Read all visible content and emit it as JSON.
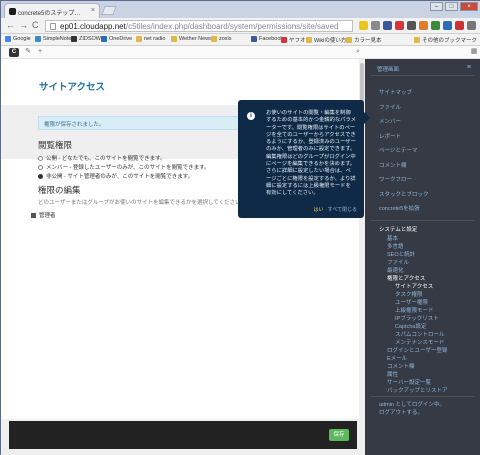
{
  "browser": {
    "tab_title": "concrete5のステップ…",
    "url_host": "ep01.cloudapp.net",
    "url_path": "/c5tiles/index.php/dashboard/system/permissions/site/saved",
    "back_glyph": "←",
    "forward_glyph": "→",
    "reload_glyph": "C",
    "close_tab_glyph": "×"
  },
  "bookmarks": {
    "items": [
      {
        "label": "Google",
        "color": "#4285f4"
      },
      {
        "label": "SimpleNote",
        "color": "#3b8ec2"
      },
      {
        "label": "ZIDSOW",
        "color": "#333333"
      },
      {
        "label": "OneDrive",
        "color": "#2a6ebb"
      },
      {
        "label": "net radio",
        "color": "#e0b84a"
      },
      {
        "label": "Wether News",
        "color": "#e0b84a"
      },
      {
        "label": "zoxis",
        "color": "#e0b84a"
      },
      {
        "label": "Facebook",
        "color": "#3b5998"
      },
      {
        "label": "ヤフオク",
        "color": "#d8343a"
      },
      {
        "label": "Wikiの使い方",
        "color": "#e0b84a"
      },
      {
        "label": "カラー見本",
        "color": "#e0b84a"
      }
    ],
    "other": "その他のブックマーク"
  },
  "c5toolbar": {
    "logo": "C",
    "edit_icon": "✎",
    "add_icon": "+",
    "search_icon": "⌕",
    "dashboard_icon": "▦"
  },
  "page": {
    "title": "サイトアクセス",
    "alert": "権限が保存されました。",
    "section1": "閲覧権限",
    "options": [
      {
        "label": "公開 - どなたでも、このサイトを閲覧できます。",
        "selected": false
      },
      {
        "label": "メンバー - 登録したユーザーのみが、このサイトを閲覧できます。",
        "selected": false
      },
      {
        "label": "非公開 - サイト管理者のみが、このサイトを閲覧できます。",
        "selected": true
      }
    ],
    "section2": "権限の編集",
    "section2_desc": "どのユーザーまたはグループがお使いのサイトを編集できるかを選択してください。注意",
    "group_checked": "管理者",
    "save_label": "保存"
  },
  "tooltip": {
    "text": "お使いのサイトの閲覧・編集を制御するための基本的かつ金銭的なパラメーターです。閲覧権限はサイトのページを全てのユーザーからアクセスできるようにするか、登録済みのユーザーのみか、管理者のみに設定できます。編集権限はどのグループがログイン中にページを編集できるかを決めます。さらに詳細に設定したい場合は、ページごとに権限を設定するか、より詳細に設定するには上級権限モードを有効にしてください。",
    "info_glyph": "i",
    "yes": "はい",
    "skip": "すべて閉じる"
  },
  "panel": {
    "title": "管理画面",
    "top_items": [
      "サイトマップ",
      "ファイル",
      "メンバー",
      "レポート",
      "ページとテーマ",
      "コメント欄",
      "ワークフロー",
      "スタックとブロック",
      "concrete5を拡張"
    ],
    "system_heading": "システムと設定",
    "system_items": [
      "基本",
      "多言語",
      "SEOと統計",
      "ファイル",
      "最適化"
    ],
    "permissions_heading": "権限とアクセス",
    "permission_items": [
      "サイトアクセス",
      "タスク権限",
      "ユーザー権限",
      "上級権限モード",
      "IPブラックリスト",
      "Captcha設定",
      "スパムコントロール",
      "メンテナンスモード"
    ],
    "permissions_active_index": 0,
    "more_items": [
      "ログインとユーザー登録",
      "Eメール",
      "コメント欄",
      "属性",
      "サーバー設定一覧",
      "バックアップとリストア"
    ],
    "logged_in": "admin としてログイン中。",
    "logout": "ログアウトする。"
  },
  "colors": {
    "accent": "#1572a6",
    "tooltip_bg": "#0e2a47",
    "panel_bg": "#353a44",
    "save_green": "#5cb85c"
  }
}
